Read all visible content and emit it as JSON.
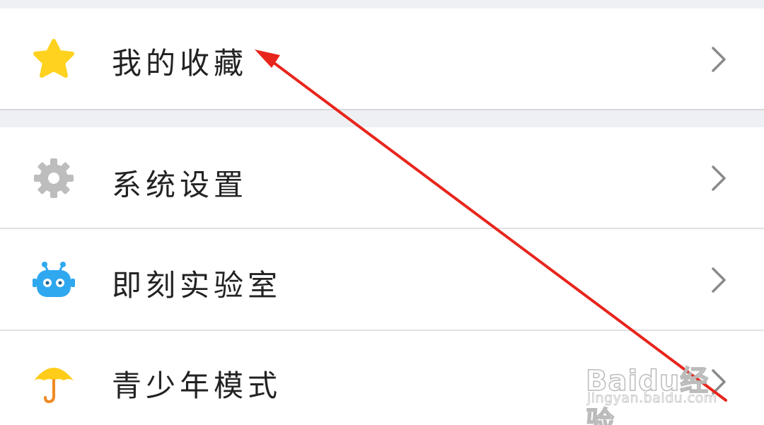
{
  "menu": {
    "items": [
      {
        "label": "我的收藏",
        "icon": "star-icon",
        "icon_color": "#FFD21F"
      },
      {
        "label": "系统设置",
        "icon": "gear-icon",
        "icon_color": "#BDBDBD"
      },
      {
        "label": "即刻实验室",
        "icon": "robot-icon",
        "icon_color": "#2FA8F0"
      },
      {
        "label": "青少年模式",
        "icon": "umbrella-icon",
        "icon_color": "#FFCC1A"
      }
    ],
    "chevron_icon": "chevron-right-icon",
    "chevron_color": "#8a8a8a"
  },
  "annotation": {
    "icon": "red-arrow-icon",
    "color": "#E8251C"
  },
  "watermark": {
    "brand": "Baidu经验",
    "url": "jingyan.baidu.com"
  }
}
